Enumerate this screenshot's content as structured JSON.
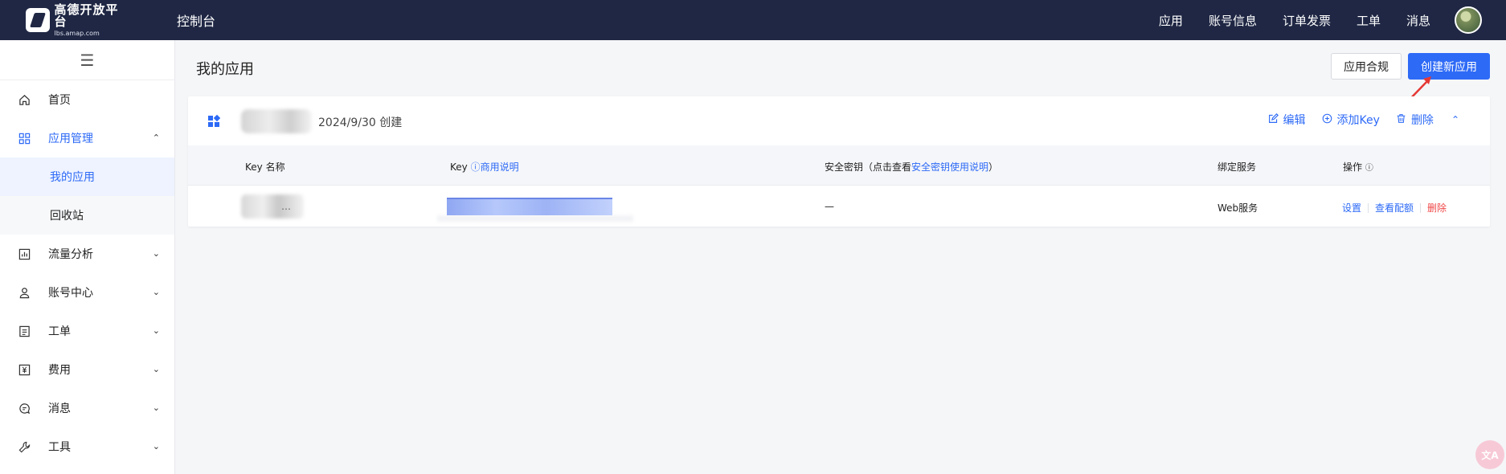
{
  "header": {
    "logo_name": "高德开放平台",
    "logo_url": "lbs.amap.com",
    "console_title": "控制台",
    "nav": [
      "应用",
      "账号信息",
      "订单发票",
      "工单",
      "消息"
    ]
  },
  "sidebar": {
    "toggle_icon": "menu-icon",
    "items": [
      {
        "label": "首页",
        "icon": "home-icon"
      },
      {
        "label": "应用管理",
        "icon": "grid-icon"
      },
      {
        "label": "流量分析",
        "icon": "chart-icon"
      },
      {
        "label": "账号中心",
        "icon": "user-icon"
      },
      {
        "label": "工单",
        "icon": "ticket-icon"
      },
      {
        "label": "费用",
        "icon": "yuan-icon"
      },
      {
        "label": "消息",
        "icon": "message-icon"
      },
      {
        "label": "工具",
        "icon": "wrench-icon"
      }
    ],
    "sub_items": [
      "我的应用",
      "回收站"
    ]
  },
  "main": {
    "title": "我的应用",
    "compliance_button": "应用合规",
    "create_button": "创建新应用"
  },
  "app_card": {
    "created": "2024/9/30 创建",
    "actions": {
      "edit": "编辑",
      "add_key": "添加Key",
      "delete": "删除"
    },
    "columns": {
      "key_name": "Key 名称",
      "key": "Key",
      "key_help": "商用说明",
      "secret_prefix": "安全密钥（点击查看",
      "secret_link": "安全密钥使用说明",
      "secret_suffix": "）",
      "service": "绑定服务",
      "ops": "操作"
    },
    "rows": [
      {
        "key_name_tail": "…",
        "secret": "—",
        "service": "Web服务",
        "ops": {
          "settings": "设置",
          "quota": "查看配额",
          "delete": "删除"
        }
      }
    ]
  },
  "colors": {
    "accent": "#2d6af6",
    "topbar": "#1f2744",
    "danger": "#f04848"
  }
}
